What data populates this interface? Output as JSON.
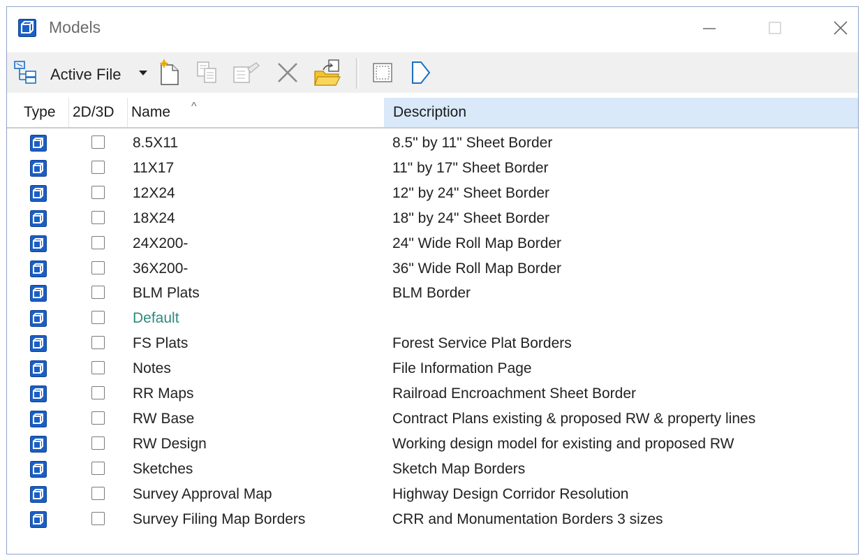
{
  "window": {
    "title": "Models",
    "controls": [
      "minimize",
      "maximize",
      "close"
    ]
  },
  "toolbar": {
    "filter_label": "Active File",
    "icons": [
      "model-hierarchy-icon",
      "filter-dropdown-arrow-icon",
      "new-model-icon",
      "copy-model-icon",
      "model-properties-icon",
      "delete-model-icon",
      "import-model-icon",
      "select-area-icon",
      "sheet-shape-icon"
    ]
  },
  "columns": {
    "type": "Type",
    "dim": "2D/3D",
    "name": "Name",
    "description": "Description"
  },
  "rows": [
    {
      "name": "8.5X11",
      "description": "8.5\" by 11\" Sheet Border"
    },
    {
      "name": "11X17",
      "description": "11\" by 17\" Sheet Border"
    },
    {
      "name": "12X24",
      "description": "12\" by 24\" Sheet Border"
    },
    {
      "name": "18X24",
      "description": "18\" by 24\" Sheet Border"
    },
    {
      "name": "24X200-",
      "description": "24\" Wide Roll Map Border"
    },
    {
      "name": "36X200-",
      "description": "36\" Wide Roll Map Border"
    },
    {
      "name": "BLM Plats",
      "description": "BLM Border"
    },
    {
      "name": "Default",
      "description": ""
    },
    {
      "name": "FS Plats",
      "description": "Forest Service Plat Borders"
    },
    {
      "name": "Notes",
      "description": "File Information Page"
    },
    {
      "name": "RR Maps",
      "description": "Railroad Encroachment Sheet Border"
    },
    {
      "name": "RW Base",
      "description": "Contract Plans existing & proposed RW & property lines"
    },
    {
      "name": "RW Design",
      "description": "Working design model for existing and proposed RW"
    },
    {
      "name": "Sketches",
      "description": "Sketch Map Borders"
    },
    {
      "name": "Survey Approval Map",
      "description": "Highway Design Corridor Resolution"
    },
    {
      "name": "Survey Filing Map Borders",
      "description": "CRR and Monumentation Borders 3 sizes"
    }
  ],
  "colors": {
    "accent": "#1976d2",
    "header_highlight": "#d9e9f9",
    "default_model_text": "#2d8a7e"
  }
}
